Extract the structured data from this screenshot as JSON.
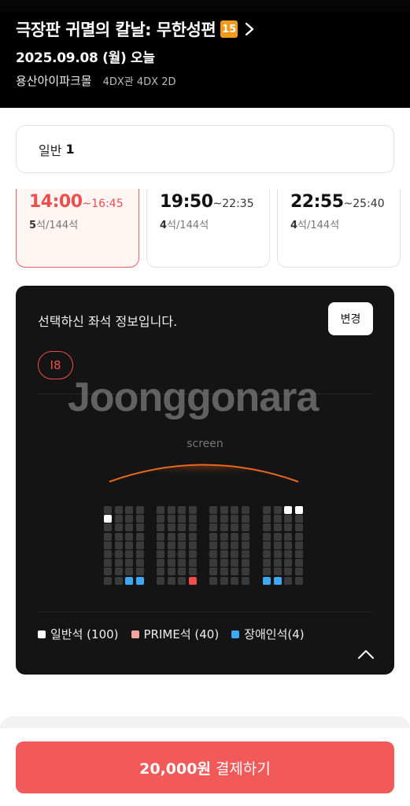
{
  "header": {
    "movie_title": "극장판 귀멸의 칼날: 무한성편",
    "age_rating": "15",
    "date_text": "2025.09.08 (월) 오늘",
    "theater_name": "용산아이파크몰",
    "screen_type": "4DX관 4DX 2D"
  },
  "ticket": {
    "label": "일반",
    "count": "1"
  },
  "timeslots": [
    {
      "start": "14:00",
      "end": "~16:45",
      "remaining": "5",
      "total": "석/144석",
      "selected": true
    },
    {
      "start": "19:50",
      "end": "~22:35",
      "remaining": "4",
      "total": "석/144석",
      "selected": false
    },
    {
      "start": "22:55",
      "end": "~25:40",
      "remaining": "4",
      "total": "석/144석",
      "selected": false
    }
  ],
  "seat_info": {
    "title": "선택하신 좌석 정보입니다.",
    "change_label": "변경",
    "selected_seat": "I8",
    "watermark": "Joonggonara",
    "screen_label": "screen"
  },
  "legend": [
    {
      "label": "일반석 (100)",
      "color": "#ffffff"
    },
    {
      "label": "PRIME석 (40)",
      "color": "#f5a3a3"
    },
    {
      "label": "장애인석(4)",
      "color": "#3ea8f5"
    }
  ],
  "seat_colors": {
    "default": "#3a3a3a",
    "general": "#ffffff",
    "accessible": "#3ea8f5",
    "selected": "#f04d4d"
  },
  "payment": {
    "amount": "20,000원",
    "action": "결제하기"
  }
}
